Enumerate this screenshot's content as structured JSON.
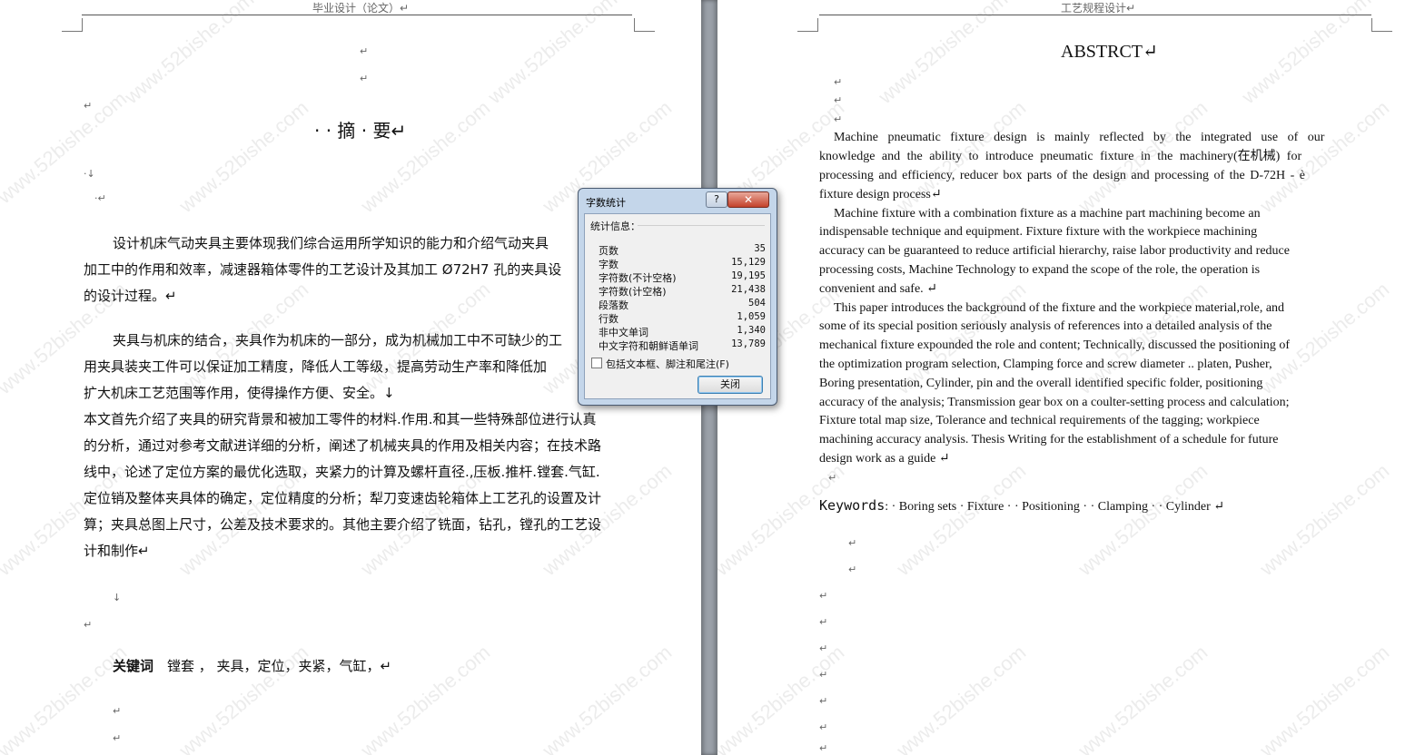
{
  "left_page": {
    "header": "毕业设计（论文）↵",
    "title": "· · 摘 · 要↵",
    "marks_top": [
      "↵",
      "↵",
      "↵",
      "·↓",
      "·↵"
    ],
    "para1": [
      "设计机床气动夹具主要体现我们综合运用所学知识的能力和介绍气动夹具",
      "加工中的作用和效率，减速器箱体零件的工艺设计及其加工 Ø72H7 孔的夹具设",
      "的设计过程。↵"
    ],
    "para2": [
      "夹具与机床的结合，夹具作为机床的一部分，成为机械加工中不可缺少的工",
      "用夹具装夹工件可以保证加工精度，降低人工等级，提高劳动生产率和降低加",
      "扩大机床工艺范围等作用，使得操作方便、安全。↓"
    ],
    "para3": [
      "本文首先介绍了夹具的研究背景和被加工零件的材料.作用.和其一些特殊部位进行认真",
      "的分析，通过对参考文献进详细的分析，阐述了机械夹具的作用及相关内容；在技术路",
      "线中，论述了定位方案的最优化选取，夹紧力的计算及螺杆直径.,压板.推杆.镗套.气缸.",
      "定位销及整体夹具体的确定，定位精度的分析；犁刀变速齿轮箱体上工艺孔的设置及计",
      "算；夹具总图上尺寸，公差及技术要求的。其他主要介绍了铣面，钻孔，镗孔的工艺设",
      "计和制作↵"
    ],
    "marks_mid": [
      "↓",
      "↵"
    ],
    "keywords_label": "关键词",
    "keywords": "镗套 ， 夹具，定位，夹紧，气缸，↵",
    "marks_bottom": [
      "↵",
      "↵"
    ]
  },
  "right_page": {
    "header": "工艺规程设计↵",
    "title": "ABSTRCT↵",
    "marks_top": [
      "↵",
      "↵",
      "↵"
    ],
    "lines": [
      "Machine pneumatic fixture design is mainly reflected by the integrated use of our",
      "knowledge and the ability to introduce pneumatic fixture in the machinery(在机械) for",
      "processing and efficiency, reducer box parts of the design and processing of the D-72H - è",
      "fixture design process↵",
      "Machine fixture with a combination fixture as a machine part machining become an",
      "indispensable technique and equipment. Fixture fixture with the workpiece machining",
      "accuracy can be guaranteed to reduce artificial hierarchy, raise labor productivity and reduce",
      "processing costs, Machine Technology to expand the scope of the role, the operation is",
      "convenient and safe. ↵",
      "This paper introduces the background of the fixture and the workpiece material,role, and",
      "some of its special position seriously analysis of references into a detailed analysis of the",
      "mechanical fixture expounded the role and content; Technically, discussed the positioning of",
      "the optimization program selection, Clamping force and screw diameter .. platen, Pusher,",
      "Boring presentation, Cylinder, pin and the overall identified specific folder, positioning",
      "accuracy of the analysis; Transmission gear box on a coulter-setting process and calculation;",
      "Fixture total map size, Tolerance and technical requirements of the tagging; workpiece",
      "machining accuracy analysis. Thesis Writing for the establishment of a schedule for future",
      "design work as a guide ↵"
    ],
    "mark_after": "↵",
    "keywords_label": "Keywords",
    "keywords": ": · Boring sets · Fixture · · Positioning · · Clamping · · Cylinder ↵",
    "marks_bottom": [
      "↵",
      "↵",
      "↵",
      "↵",
      "↵",
      "↵",
      "↵",
      "↵",
      "↵"
    ]
  },
  "dialog": {
    "title": "字数统计",
    "help": "?",
    "close": "✕",
    "section": "统计信息：",
    "stats": [
      {
        "label": "页数",
        "value": "35"
      },
      {
        "label": "字数",
        "value": "15,129"
      },
      {
        "label": "字符数(不计空格)",
        "value": "19,195"
      },
      {
        "label": "字符数(计空格)",
        "value": "21,438"
      },
      {
        "label": "段落数",
        "value": "504"
      },
      {
        "label": "行数",
        "value": "1,059"
      },
      {
        "label": "非中文单词",
        "value": "1,340"
      },
      {
        "label": "中文字符和朝鲜语单词",
        "value": "13,789"
      }
    ],
    "checkbox_label": "包括文本框、脚注和尾注(F)",
    "ok_label": "关闭"
  },
  "watermark": "www.52bishe.com"
}
